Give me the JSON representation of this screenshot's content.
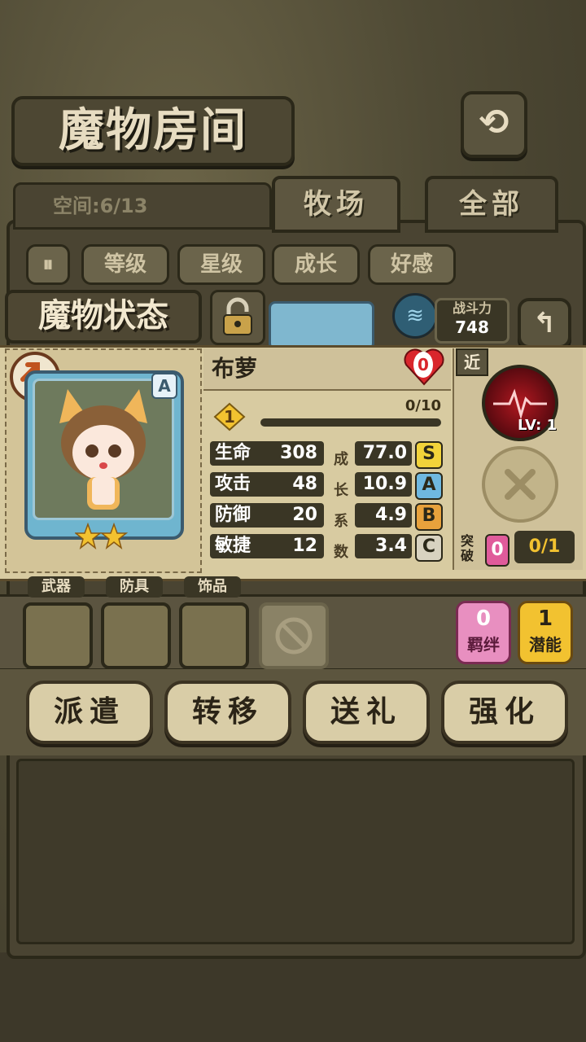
{
  "header": {
    "title": "魔物房间"
  },
  "space": {
    "label": "空间:6/13"
  },
  "tabs": [
    {
      "label": "牧场"
    },
    {
      "label": "全部"
    }
  ],
  "sort": {
    "buttons": [
      "等级",
      "星级",
      "成长",
      "好感"
    ]
  },
  "status": {
    "title": "魔物状态",
    "power_label": "战斗力",
    "power_value": "748"
  },
  "monster": {
    "name": "布萝",
    "rank": "A",
    "heart_count": "0",
    "level": "1",
    "exp": "0/10",
    "stars": 2,
    "stats": [
      {
        "name": "生命",
        "value": "308",
        "growth": "77.0",
        "grade": "S"
      },
      {
        "name": "攻击",
        "value": "48",
        "growth": "10.9",
        "grade": "A"
      },
      {
        "name": "防御",
        "value": "20",
        "growth": "4.9",
        "grade": "B"
      },
      {
        "name": "敏捷",
        "value": "12",
        "growth": "3.4",
        "grade": "C"
      }
    ],
    "growth_vertical": [
      "成",
      "长",
      "系",
      "数"
    ],
    "attack_type": "近",
    "skill_level": "LV: 1",
    "breakthrough_label": "突破",
    "breakthrough_count": "0",
    "breakthrough_progress": "0/1"
  },
  "equipment": {
    "slots": [
      "武器",
      "防具",
      "饰品"
    ]
  },
  "bond": {
    "count": "0",
    "label": "羁绊"
  },
  "potential": {
    "count": "1",
    "label": "潜能"
  },
  "actions": [
    {
      "label": "派遣"
    },
    {
      "label": "转移"
    },
    {
      "label": "送礼"
    },
    {
      "label": "强化"
    }
  ],
  "colors": {
    "gold": "#f2c230",
    "S": "#f2d33a",
    "A": "#6fb8e0",
    "B": "#e8a23c",
    "C": "#d8d2c0",
    "heart": "#d9262c"
  }
}
